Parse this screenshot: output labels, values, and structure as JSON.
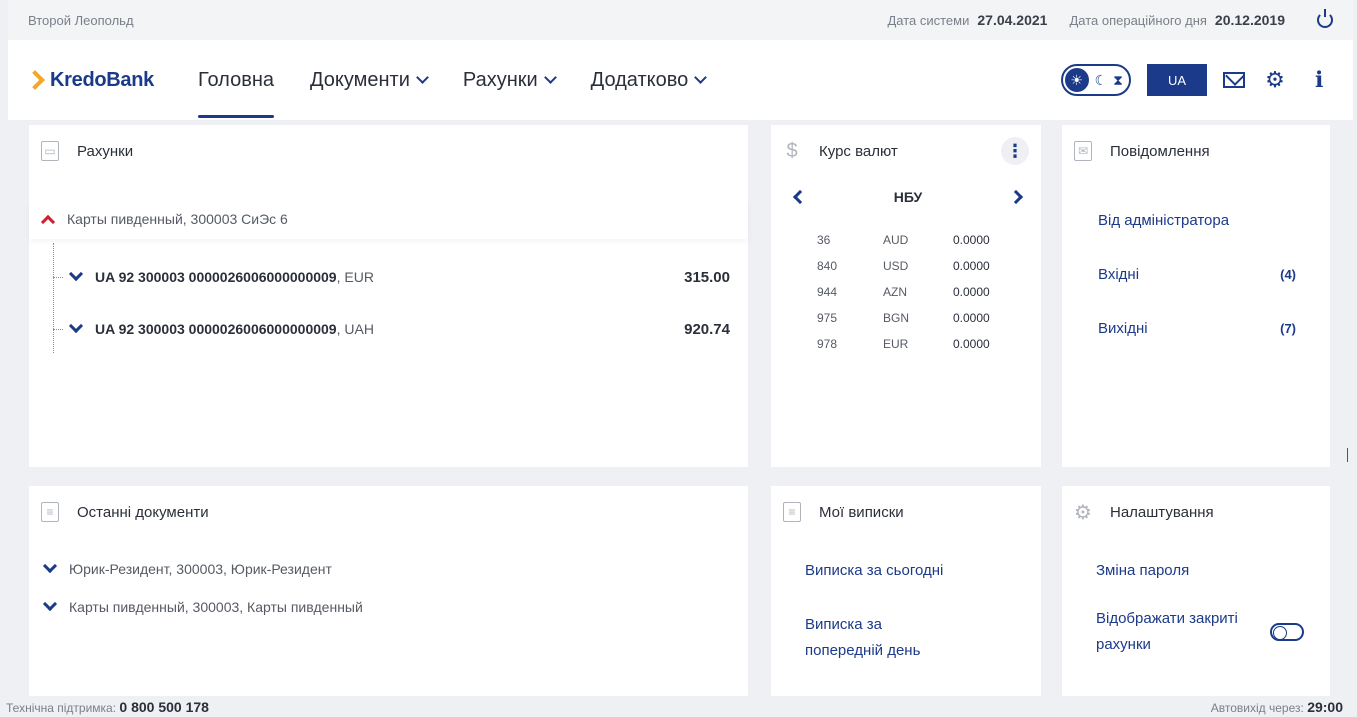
{
  "sysbar": {
    "user": "Второй Леопольд",
    "system_date_label": "Дата системи",
    "system_date": "27.04.2021",
    "op_date_label": "Дата операційного дня",
    "op_date": "20.12.2019"
  },
  "header": {
    "logo": "KredoBank",
    "nav": [
      {
        "label": "Головна",
        "active": true
      },
      {
        "label": "Документи",
        "dropdown": true
      },
      {
        "label": "Рахунки",
        "dropdown": true
      },
      {
        "label": "Додатково",
        "dropdown": true
      }
    ],
    "lang": "UA",
    "icons": [
      "sun-icon",
      "moon-icon",
      "hourglass-icon",
      "mail-icon",
      "gear-icon",
      "info-icon"
    ]
  },
  "accounts": {
    "title": "Рахунки",
    "group": "Карты пивденный, 300003 СиЭс 6",
    "rows": [
      {
        "iban": "UA 92 300003 0000026006000000009",
        "currency": ", EUR",
        "amount": "315.00"
      },
      {
        "iban": "UA 92 300003 0000026006000000009",
        "currency": ", UAH",
        "amount": "920.74"
      }
    ]
  },
  "rates": {
    "title": "Курс валют",
    "source": "НБУ",
    "rows": [
      {
        "code": "36",
        "cur": "AUD",
        "rate": "0.0000"
      },
      {
        "code": "840",
        "cur": "USD",
        "rate": "0.0000"
      },
      {
        "code": "944",
        "cur": "AZN",
        "rate": "0.0000"
      },
      {
        "code": "975",
        "cur": "BGN",
        "rate": "0.0000"
      },
      {
        "code": "978",
        "cur": "EUR",
        "rate": "0.0000"
      }
    ]
  },
  "messages": {
    "title": "Повідомлення",
    "admin": "Від адміністратора",
    "inbox": "Вхідні",
    "inbox_count": "(4)",
    "outbox": "Вихідні",
    "outbox_count": "(7)"
  },
  "recent": {
    "title": "Останні документи",
    "items": [
      "Юрик-Резидент, 300003, Юрик-Резидент",
      "Карты пивденный, 300003, Карты пивденный"
    ]
  },
  "statements": {
    "title": "Мої виписки",
    "today": "Виписка за сьогодні",
    "prev_line1": "Виписка за",
    "prev_line2": "попередній день"
  },
  "settings": {
    "title": "Налаштування",
    "change_password": "Зміна пароля",
    "show_closed_line1": "Відображати закриті",
    "show_closed_line2": "рахунки"
  },
  "footer": {
    "support_label": "Технічна підтримка:",
    "support_phone": "0 800 500 178",
    "autologout_label": "Автовихід через:",
    "autologout_time": "29:00"
  },
  "colors": {
    "brand": "#1c3a8a",
    "accent": "#f5a623",
    "alert": "#d0202e"
  }
}
